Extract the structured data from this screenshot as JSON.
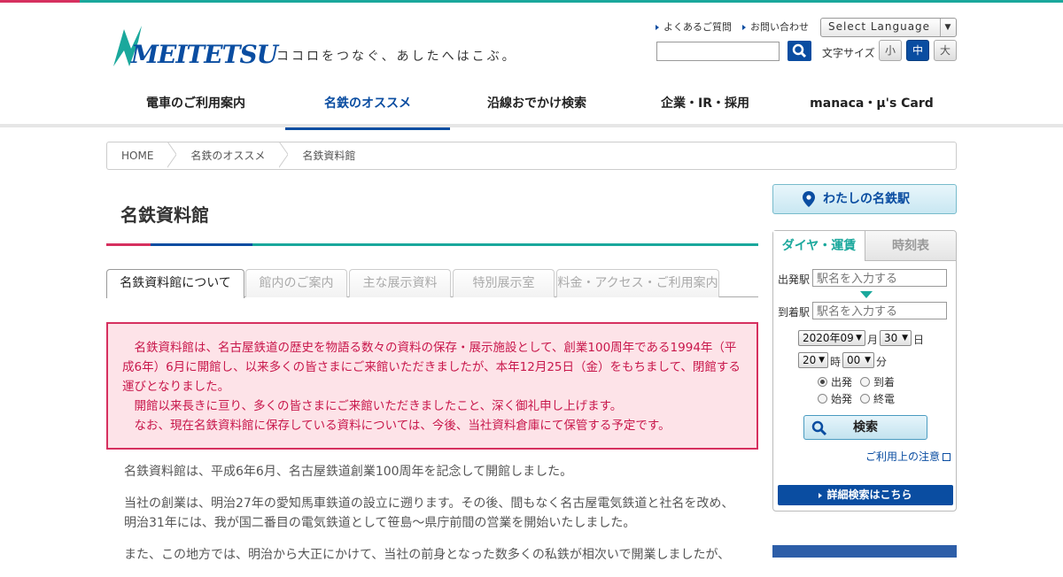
{
  "header": {
    "logo_text": "MEITETSU",
    "tagline": "ココロをつなぐ、あしたへはこぶ。",
    "util_links": [
      "よくあるご質問",
      "お問い合わせ"
    ],
    "language_label": "Select Language",
    "font_size_label": "文字サイズ",
    "font_sizes": [
      "小",
      "中",
      "大"
    ],
    "font_size_active": "中"
  },
  "nav": {
    "items": [
      "電車のご利用案内",
      "名鉄のオススメ",
      "沿線おでかけ検索",
      "企業・IR・採用",
      "manaca・μ's Card"
    ],
    "active": "名鉄のオススメ"
  },
  "breadcrumb": [
    "HOME",
    "名鉄のオススメ",
    "名鉄資料館"
  ],
  "page": {
    "title": "名鉄資料館",
    "tabs": [
      "名鉄資料館について",
      "館内のご案内",
      "主な展示資料",
      "特別展示室",
      "料金・アクセス・ご利用案内"
    ],
    "notice": [
      "名鉄資料館は、名古屋鉄道の歴史を物語る数々の資料の保存・展示施設として、創業100周年である1994年（平成6年）6月に開館し、以来多くの皆さまにご来館いただきましたが、本年12月25日（金）をもちまして、閉館する運びとなりました。",
      "開館以来長きに亘り、多くの皆さまにご来館いただきましたこと、深く御礼申し上げます。",
      "なお、現在名鉄資料館に保存している資料については、今後、当社資料倉庫にて保管する予定です。"
    ],
    "body": [
      "名鉄資料館は、平成6年6月、名古屋鉄道創業100周年を記念して開館しました。",
      "当社の創業は、明治27年の愛知馬車鉄道の設立に遡ります。その後、間もなく名古屋電気鉄道と社名を改め、明治31年には、我が国二番目の電気鉄道として笹島～県庁前間の営業を開始いたしました。",
      "また、この地方では、明治から大正にかけて、当社の前身となった数多くの私鉄が相次いで開業しましたが、"
    ]
  },
  "sidebar": {
    "my_station": "わたしの名鉄駅",
    "tabs": [
      "ダイヤ・運賃",
      "時刻表"
    ],
    "from_label": "出発駅",
    "to_label": "到着駅",
    "station_placeholder": "駅名を入力する",
    "year_month": "2020年09",
    "month_unit": "月",
    "day": "30",
    "day_unit": "日",
    "hour": "20",
    "hour_unit": "時",
    "minute": "00",
    "minute_unit": "分",
    "radios": [
      "出発",
      "到着",
      "始発",
      "終電"
    ],
    "radio_selected": "出発",
    "search_label": "検索",
    "note_link": "ご利用上の注意",
    "detail_link": "詳細検索はこちら"
  },
  "colors": {
    "brand_blue": "#0a4da1",
    "teal": "#1aa89c",
    "pink": "#d6305f"
  }
}
